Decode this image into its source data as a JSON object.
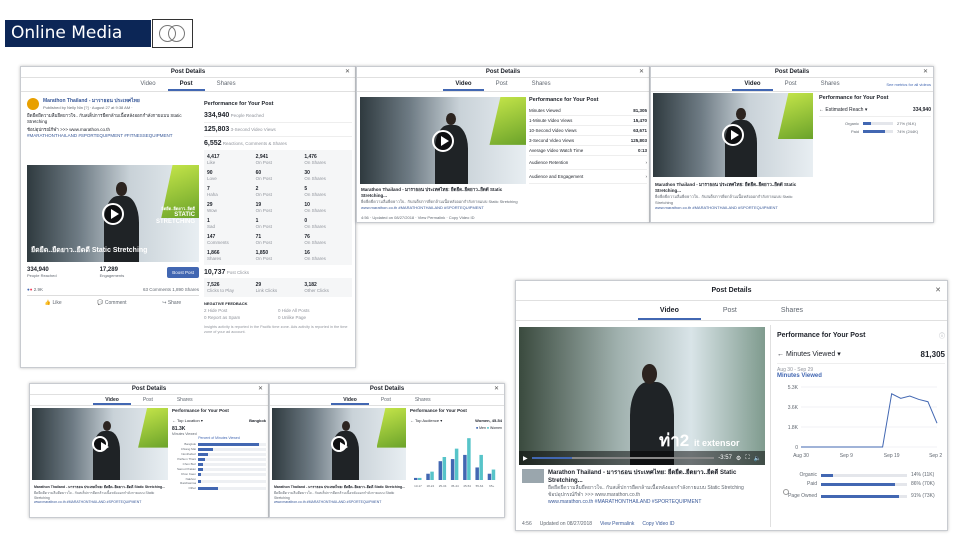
{
  "slide_title": "Online Media",
  "icons": [
    "logo-circles-icon",
    "close-icon",
    "play-icon",
    "gear-icon",
    "info-icon"
  ],
  "panel1": {
    "header": "Post Details",
    "tabs": [
      "Video",
      "Post",
      "Shares"
    ],
    "page_name": "Marathon Thailand - มาราธอน ประเทศไทย",
    "published": "Published by Nelly Nin [?] · August 27 at 9:38 AM ·",
    "post_text": "ยืดยืดยืดวามลืมยืดยาวใจ.. กับสเต็ปการยืดกล้ามเนื้อหลังออกกำลังกายแบบ Static Stretching",
    "post_text2": "ช้อปอุปกรณ์กีฬา >>> www.marathon.co.th",
    "hashtags": "#MARATHONTHAILAND #SPORTEQUIPMENT #FITNESSEQUIPMENT",
    "video_caption": "ยืดยืด..ยืดยาว..ยืดดี Static Stretching",
    "video_badge_1": "ยืดยืด..ยืดยาว..ยืดดี",
    "video_badge_2": "STATIC",
    "video_badge_3": "STRETCHING",
    "people_reached": "334,940",
    "people_reached_label": "People Reached",
    "engagements": "17,289",
    "engagements_label": "Engagements",
    "boost": "Boost Post",
    "reactions_count": "2.9K",
    "comments_shares": "63 Comments  1,890 Shares",
    "actions": [
      "Like",
      "Comment",
      "Share"
    ],
    "perf_title": "Performance for Your Post",
    "reached": "334,940",
    "reached_label": "People Reached",
    "views": "125,803",
    "views_label": "3-Second Video Views",
    "rcs": "6,552",
    "rcs_label": "Reactions, Comments & Shares",
    "grid": [
      [
        "4,417",
        "Like",
        "2,941",
        "On Post",
        "1,476",
        "On Shares"
      ],
      [
        "90",
        "Love",
        "60",
        "On Post",
        "30",
        "On Shares"
      ],
      [
        "7",
        "Haha",
        "2",
        "On Post",
        "5",
        "On Shares"
      ],
      [
        "29",
        "Wow",
        "19",
        "On Post",
        "10",
        "On Shares"
      ],
      [
        "1",
        "Sad",
        "1",
        "On Post",
        "0",
        "On Shares"
      ],
      [
        "147",
        "Comments",
        "71",
        "On Post",
        "76",
        "On Shares"
      ],
      [
        "1,866",
        "Shares",
        "1,850",
        "On Post",
        "16",
        "On Shares"
      ]
    ],
    "clicks": "10,737",
    "clicks_label": "Post Clicks",
    "click_grid": [
      [
        "7,526",
        "Clicks to Play"
      ],
      [
        "29",
        "Link Clicks"
      ],
      [
        "3,182",
        "Other Clicks"
      ]
    ],
    "negative": "NEGATIVE FEEDBACK",
    "neg_items": [
      "2 Hide Post",
      "0 Hide All Posts",
      "0 Report as Spam",
      "0 Unlike Page"
    ],
    "footnote": "Insights activity is reported in the Pacific time zone. Ads activity is reported in the time zone of your ad account."
  },
  "panel2": {
    "header": "Post Details",
    "tabs": [
      "Video",
      "Post",
      "Shares"
    ],
    "perf_title": "Performance for Your Post",
    "metrics": [
      [
        "Minutes Viewed",
        "81,305"
      ],
      [
        "1-Minute Video Views",
        "15,470"
      ],
      [
        "10-Second Video Views",
        "63,671"
      ],
      [
        "3-Second Video Views",
        "125,803"
      ],
      [
        "Average Video Watch Time",
        "0:13"
      ]
    ],
    "sections": [
      "Audience Retention",
      "Audience and Engagement"
    ],
    "caption_title": "Marathon Thailand - มาราธอน ประเทศไทย: ยืดยืด..ยืดยาว..ยืดดี Static Stretching...",
    "caption_text": "ยืดยืดยืดวามลืมยืดยาวใจ.. กับสเต็ปการยืดกล้ามเนื้อหลังออกกำลังกายแบบ Static Stretching",
    "caption_link": "www.marathon.co.th #MARATHONTHAILAND #SPORTEQUIPMENT",
    "footer": "4:56  ·  Updated on 08/27/2018  ·  View Permalink  ·  Copy Video ID"
  },
  "panel3": {
    "header": "Post Details",
    "tabs": [
      "Video",
      "Post",
      "Shares"
    ],
    "see_metrics": "See metrics for all videos",
    "perf_title": "Performance for Your Post",
    "metric": "Estimated Reach",
    "metric_value": "334,940",
    "rows": [
      [
        "Organic",
        "27% (91K)",
        27
      ],
      [
        "Paid",
        "74% (244K)",
        74
      ]
    ]
  },
  "panel4": {
    "header": "Post Details",
    "tabs": [
      "Video",
      "Post",
      "Shares"
    ],
    "perf_title": "Performance for Your Post",
    "metric": "Minutes Viewed",
    "metric_value": "81,305",
    "date_range": "Aug 30 - Sep 29",
    "series_label": "Minutes Viewed",
    "video_text": "ท่า2",
    "video_text2": "it extensor",
    "time": "-3:57",
    "caption_title": "Marathon Thailand - มาราธอน ประเทศไทย: ยืดยืด..ยืดยาว..ยืดดี Static Stretching...",
    "caption_text": "ยืดยืดยืดวามลืมยืดยาวใจ.. กับสเต็ปการยืดกล้ามเนื้อหลังออกกำลังกายแบบ Static Stretching",
    "caption_text2": "ช้อปอุปกรณ์กีฬา >>> www.marathon.co.th",
    "caption_link": "www.marathon.co.th #MARATHONTHAILAND #SPORTEQUIPMENT",
    "footer_time": "4:56",
    "footer": "Updated on 08/27/2018",
    "permalink": "View Permalink",
    "copy": "Copy Video ID",
    "breakdown": [
      [
        "Organic",
        "14% (11K)",
        14
      ],
      [
        "Paid",
        "86% (70K)",
        86
      ]
    ],
    "page_owned_label": "Page Owned",
    "page_owned": "91% (73K)",
    "page_owned_pct": 91
  },
  "panel5": {
    "header": "Post Details",
    "tabs": [
      "Video",
      "Post",
      "Shares"
    ],
    "perf_title": "Performance for Your Post",
    "metric": "Top Location",
    "metric_value": "Bangkok",
    "sub_value": "81.3K",
    "sub_label": "Minutes Viewed",
    "link": "Percent of Minutes Viewed",
    "bars": [
      [
        "Bangkok",
        90
      ],
      [
        "Chiang Mai",
        22
      ],
      [
        "Nonthaburi",
        15
      ],
      [
        "Pathum Thani",
        10
      ],
      [
        "Chon Buri",
        8
      ],
      [
        "Samut Prakan",
        7
      ],
      [
        "Khon Kaen",
        5
      ],
      [
        "Nakhon Ratchasima",
        4
      ],
      [
        "Other",
        30
      ]
    ]
  },
  "panel6": {
    "header": "Post Details",
    "tabs": [
      "Video",
      "Post",
      "Shares"
    ],
    "perf_title": "Performance for Your Post",
    "metric": "Top Audience",
    "metric_value": "Women, 45-54",
    "legend": [
      "Men",
      "Women"
    ],
    "groups": [
      "13-17",
      "18-24",
      "25-34",
      "35-44",
      "45-54",
      "55-64",
      "65+"
    ],
    "men": [
      1,
      3,
      9,
      10,
      12,
      6,
      3
    ],
    "women": [
      1,
      4,
      11,
      15,
      20,
      12,
      5
    ]
  },
  "chart_data": {
    "type": "line",
    "title": "Minutes Viewed",
    "x_ticks": [
      "Aug 30",
      "Sep 9",
      "Sep 19",
      "Sep 29"
    ],
    "y_ticks": [
      "5.3K",
      "3.6K",
      "1.8K",
      "0"
    ],
    "ylim": [
      0,
      5300
    ],
    "x": [
      0,
      2,
      4,
      6,
      8,
      10,
      12,
      14,
      16,
      18,
      20,
      22,
      24,
      26,
      28,
      30
    ],
    "values": [
      0,
      0,
      0,
      0,
      0,
      0,
      0,
      0,
      0,
      0,
      4700,
      4300,
      4500,
      4200,
      4000,
      2100
    ]
  }
}
